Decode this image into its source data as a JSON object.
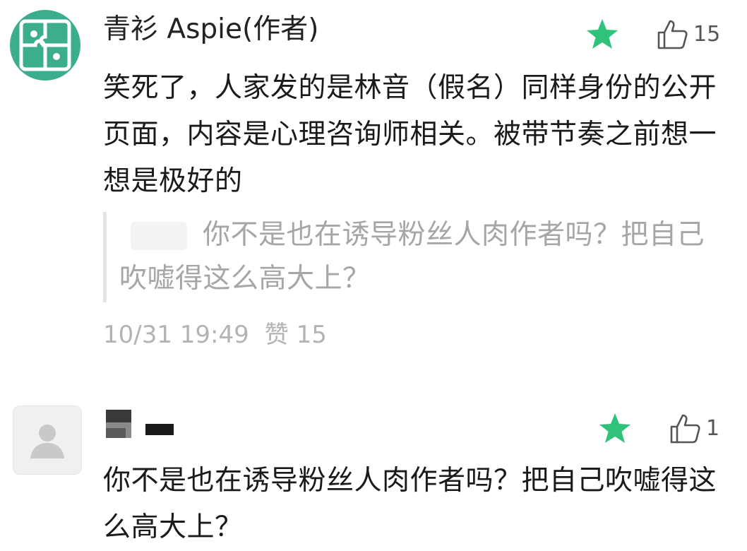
{
  "comments": [
    {
      "author": "青衫 Aspie(作者)",
      "avatar_icon": "puzzle-icon",
      "is_featured": true,
      "like_count": "15",
      "text": "笑死了，人家发的是林音（假名）同样身份的公开页面，内容是心理咨询师相关。被带节奏之前想一想是极好的",
      "quote": "你不是也在诱导粉丝人肉作者吗？把自己吹嘘得这么高大上？",
      "time": "10/31 19:49",
      "likes_text": "赞 15"
    },
    {
      "author": "",
      "avatar_icon": "default-user-icon",
      "is_featured": true,
      "like_count": "1",
      "text": "你不是也在诱导粉丝人肉作者吗？把自己吹嘘得这么高大上？"
    }
  ],
  "colors": {
    "featured_star": "#2fc27a",
    "author_avatar": "#3cae8d",
    "secondary_text": "#b3b3b3",
    "quote_text": "#a6a6a6"
  }
}
